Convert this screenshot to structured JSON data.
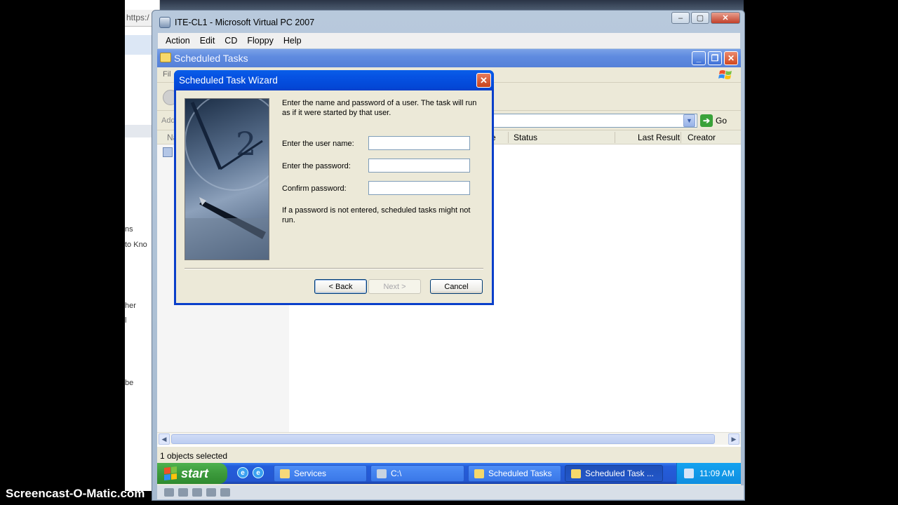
{
  "background_browser": {
    "address_fragment": "https:/",
    "text_fragments": [
      "ns",
      "to Kno",
      "her",
      "l",
      "be"
    ]
  },
  "vpc": {
    "title": "ITE-CL1 - Microsoft Virtual PC 2007",
    "menu": [
      "Action",
      "Edit",
      "CD",
      "Floppy",
      "Help"
    ]
  },
  "explorer": {
    "title": "Scheduled Tasks",
    "menu_fragment": "Fil",
    "address_fragment": "Add",
    "go_label": "Go",
    "columns": {
      "name_fragment": "Na",
      "schedule_fragment": "e",
      "status": "Status",
      "last_result": "Last Result",
      "creator": "Creator"
    },
    "status_text": "1 objects selected"
  },
  "wizard": {
    "title": "Scheduled Task Wizard",
    "intro": "Enter the name and password of a user.  The task will run as if it were started by that user.",
    "username_label": "Enter the user name:",
    "password_label": "Enter the password:",
    "confirm_label": "Confirm password:",
    "username_value": "",
    "password_value": "",
    "confirm_value": "",
    "note": "If a password is not entered, scheduled tasks might not run.",
    "back_label": "< Back",
    "next_label": "Next >",
    "cancel_label": "Cancel"
  },
  "taskbar": {
    "start_label": "start",
    "items": [
      {
        "label": "Services",
        "icon": "gear-icon"
      },
      {
        "label": "C:\\",
        "icon": "drive-icon"
      },
      {
        "label": "Scheduled Tasks",
        "icon": "folder-icon"
      },
      {
        "label": "Scheduled Task ...",
        "icon": "folder-icon"
      }
    ],
    "clock": "11:09 AM"
  },
  "watermark": "Screencast-O-Matic.com",
  "colors": {
    "xp_title_blue": "#0347d6",
    "taskbar_blue": "#245edb",
    "start_green": "#3c9a3c"
  }
}
